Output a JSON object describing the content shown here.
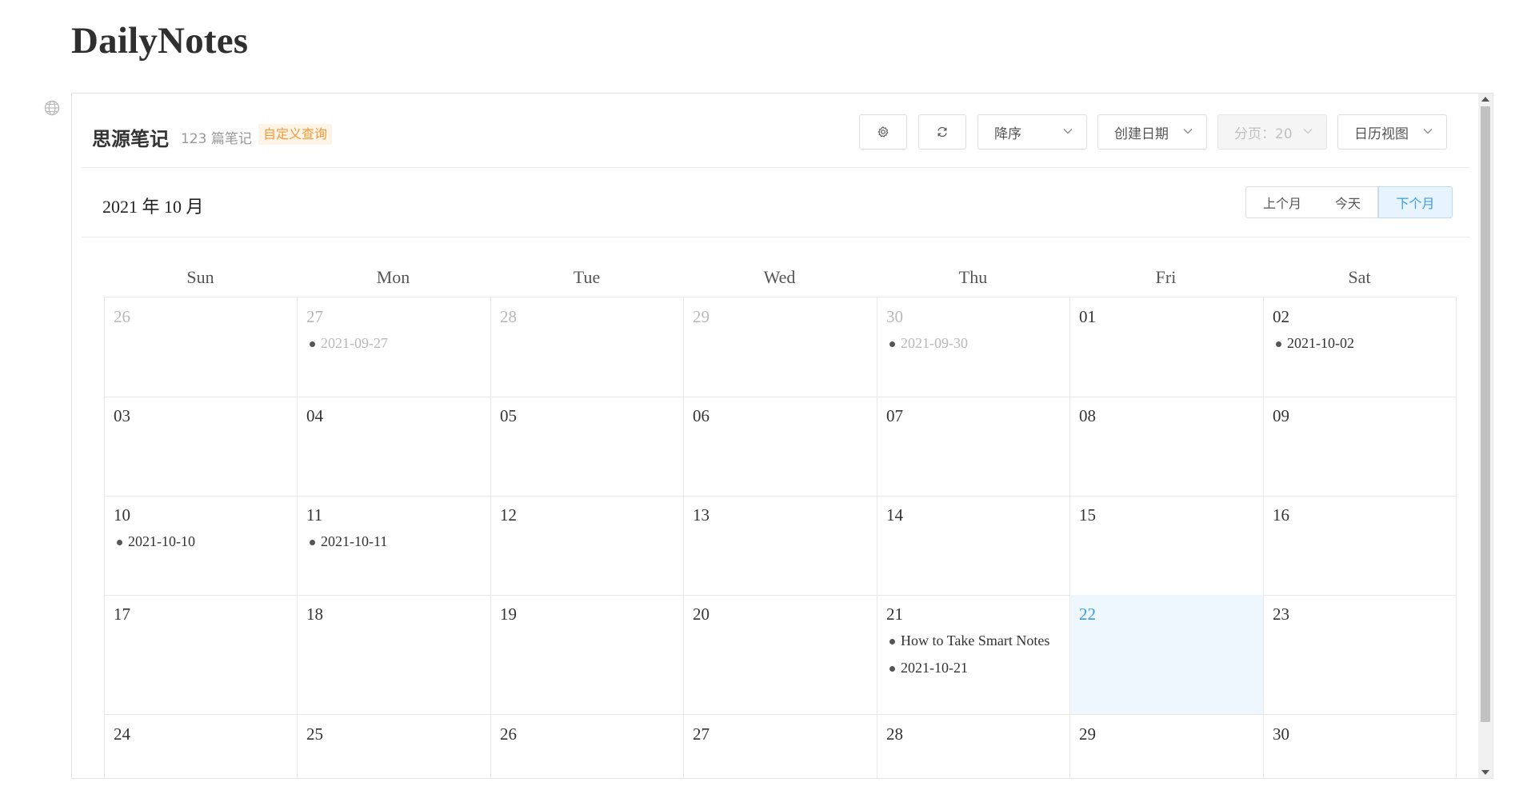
{
  "page": {
    "title": "DailyNotes"
  },
  "notebook": {
    "name": "思源笔记",
    "count": "123 篇笔记",
    "tag": "自定义查询"
  },
  "toolbar": {
    "settings_icon": "gear-icon",
    "refresh_icon": "refresh-icon",
    "sort_order": "降序",
    "sort_field": "创建日期",
    "page_size": "分页：20",
    "view_mode": "日历视图"
  },
  "calendar": {
    "month_label": "2021 年 10 月",
    "prev_label": "上个月",
    "today_label": "今天",
    "next_label": "下个月",
    "weekdays": [
      "Sun",
      "Mon",
      "Tue",
      "Wed",
      "Thu",
      "Fri",
      "Sat"
    ],
    "weeks": [
      [
        {
          "day": "26",
          "other": true,
          "events": []
        },
        {
          "day": "27",
          "other": true,
          "events": [
            "2021-09-27"
          ]
        },
        {
          "day": "28",
          "other": true,
          "events": []
        },
        {
          "day": "29",
          "other": true,
          "events": []
        },
        {
          "day": "30",
          "other": true,
          "events": [
            "2021-09-30"
          ]
        },
        {
          "day": "01",
          "events": []
        },
        {
          "day": "02",
          "events": [
            "2021-10-02"
          ]
        }
      ],
      [
        {
          "day": "03",
          "events": []
        },
        {
          "day": "04",
          "events": []
        },
        {
          "day": "05",
          "events": []
        },
        {
          "day": "06",
          "events": []
        },
        {
          "day": "07",
          "events": []
        },
        {
          "day": "08",
          "events": []
        },
        {
          "day": "09",
          "events": []
        }
      ],
      [
        {
          "day": "10",
          "events": [
            "2021-10-10"
          ]
        },
        {
          "day": "11",
          "events": [
            "2021-10-11"
          ]
        },
        {
          "day": "12",
          "events": []
        },
        {
          "day": "13",
          "events": []
        },
        {
          "day": "14",
          "events": []
        },
        {
          "day": "15",
          "events": []
        },
        {
          "day": "16",
          "events": []
        }
      ],
      [
        {
          "day": "17",
          "events": []
        },
        {
          "day": "18",
          "events": []
        },
        {
          "day": "19",
          "events": []
        },
        {
          "day": "20",
          "events": []
        },
        {
          "day": "21",
          "events": [
            "How to Take Smart Notes",
            "2021-10-21"
          ]
        },
        {
          "day": "22",
          "today": true,
          "events": []
        },
        {
          "day": "23",
          "events": []
        }
      ],
      [
        {
          "day": "24",
          "events": []
        },
        {
          "day": "25",
          "events": []
        },
        {
          "day": "26",
          "events": []
        },
        {
          "day": "27",
          "events": []
        },
        {
          "day": "28",
          "events": []
        },
        {
          "day": "29",
          "events": []
        },
        {
          "day": "30",
          "events": []
        }
      ]
    ]
  },
  "colors": {
    "accent": "#3a9be4",
    "today_bg": "#eef6fe",
    "tag_bg": "#fff4e6",
    "tag_fg": "#f29a3a"
  }
}
